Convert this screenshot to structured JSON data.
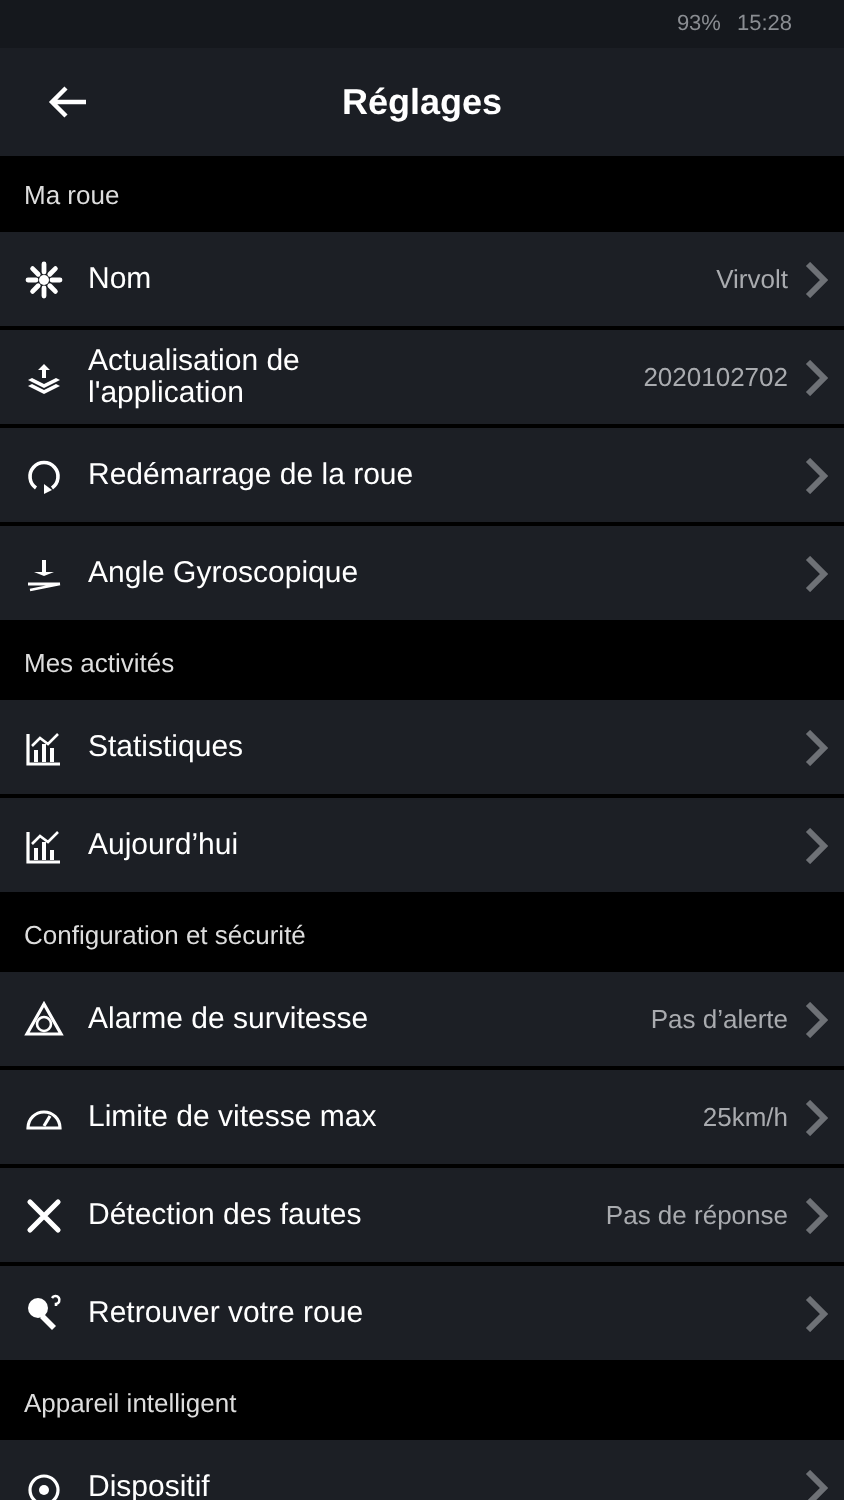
{
  "status_bar": {
    "battery": "93%",
    "time": "15:28"
  },
  "header": {
    "title": "Réglages"
  },
  "sections": [
    {
      "title": "Ma roue",
      "rows": [
        {
          "label": "Nom",
          "value": "Virvolt"
        },
        {
          "label": "Actualisation de l'application",
          "value": "2020102702"
        },
        {
          "label": "Redémarrage de la roue"
        },
        {
          "label": "Angle Gyroscopique"
        }
      ]
    },
    {
      "title": "Mes activités",
      "rows": [
        {
          "label": "Statistiques"
        },
        {
          "label": "Aujourd’hui"
        }
      ]
    },
    {
      "title": "Configuration et sécurité",
      "rows": [
        {
          "label": "Alarme de survitesse",
          "value": "Pas d’alerte"
        },
        {
          "label": "Limite de vitesse max",
          "value": "25km/h"
        },
        {
          "label": "Détection des fautes",
          "value": "Pas de réponse"
        },
        {
          "label": "Retrouver votre roue"
        }
      ]
    },
    {
      "title": "Appareil intelligent",
      "rows": [
        {
          "label": "Dispositif"
        }
      ]
    }
  ]
}
